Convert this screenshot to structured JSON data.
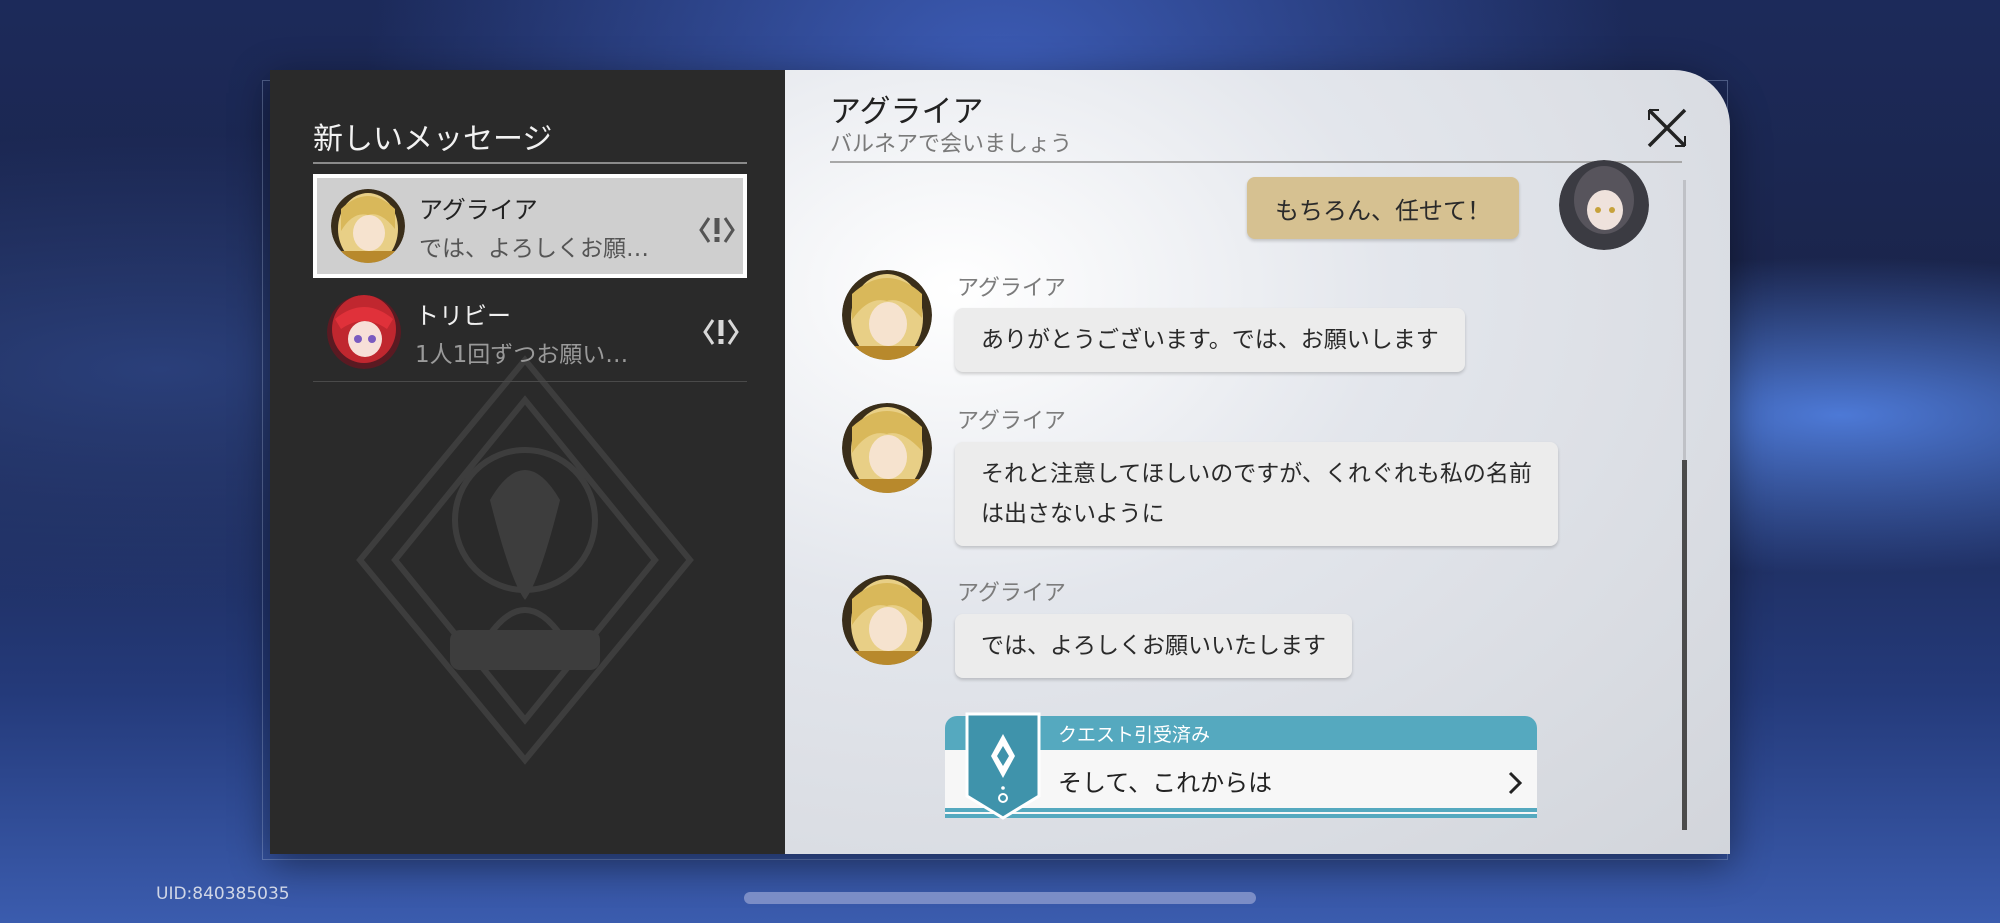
{
  "sidebar": {
    "title": "新しいメッセージ",
    "contacts": [
      {
        "name": "アグライア",
        "preview": "では、よろしくお願…",
        "avatar_icon": "aglaea-avatar",
        "selected": true
      },
      {
        "name": "トリビー",
        "preview": "1人1回ずつお願い…",
        "avatar_icon": "tribbie-avatar",
        "selected": false
      }
    ]
  },
  "chat": {
    "header": {
      "name": "アグライア",
      "subtitle": "バルネアで会いましょう"
    },
    "player_message": "もちろん、任せて！",
    "messages": [
      {
        "sender": "アグライア",
        "text": "ありがとうございます。では、お願いします"
      },
      {
        "sender": "アグライア",
        "lines": [
          "それと注意してほしいのですが、くれぐれも私の名前",
          "は出さないように"
        ]
      },
      {
        "sender": "アグライア",
        "text": "では、よろしくお願いいたします"
      }
    ],
    "quest": {
      "status": "クエスト引受済み",
      "title": "そして、これからは"
    }
  },
  "footer": {
    "uid": "UID:840385035"
  },
  "colors": {
    "player_bubble": "#d6c191",
    "npc_bubble": "#ececec",
    "quest_accent": "#55a9bf",
    "sidebar_bg": "#2a2a2a"
  }
}
